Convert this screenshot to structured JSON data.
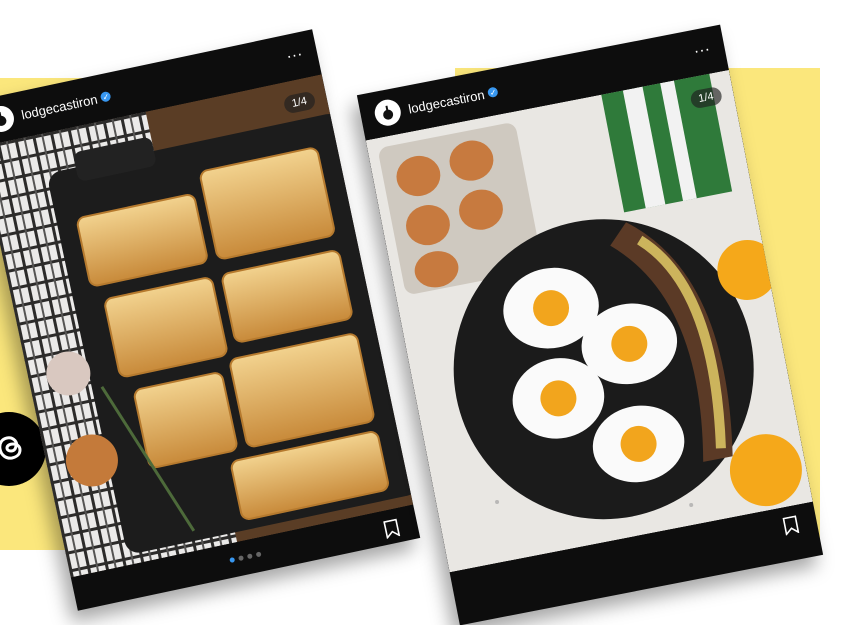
{
  "posts": [
    {
      "username": "lodgecastiron",
      "counter": "1/4",
      "more": "...",
      "dots": 4,
      "active_dot": 0
    },
    {
      "username": "lodgecastiron",
      "counter": "1/4",
      "more": "...",
      "dots": 0,
      "active_dot": 0
    }
  ],
  "colors": {
    "background_accent": "#fbe77c",
    "card": "#0d0d0d",
    "verified": "#3897f0"
  }
}
